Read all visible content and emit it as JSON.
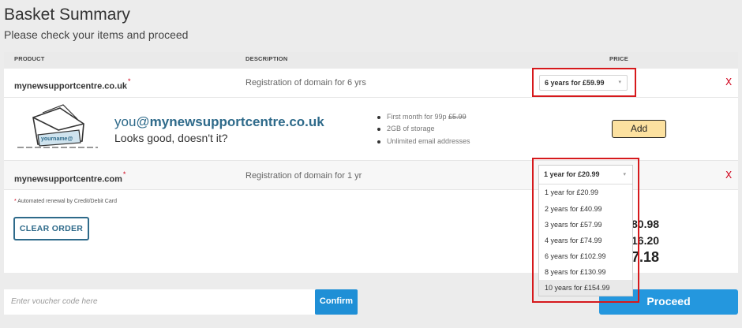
{
  "page": {
    "title": "Basket Summary",
    "subtitle": "Please check your items and proceed"
  },
  "table": {
    "headers": {
      "product": "PRODUCT",
      "description": "DESCRIPTION",
      "price": "PRICE"
    }
  },
  "items": [
    {
      "product": "mynewsupportcentre.co.uk",
      "asterisk": "*",
      "description": "Registration of domain for 6 yrs",
      "selected_price": "6 years for £59.99",
      "remove": "X"
    },
    {
      "product": "mynewsupportcentre.com",
      "asterisk": "*",
      "description": "Registration of domain for 1 yr",
      "selected_price": "1 year for £20.99",
      "remove": "X"
    }
  ],
  "email_upsell": {
    "envelope_text": "yourname@",
    "prefix": "you@",
    "domain": "mynewsupportcentre.co.uk",
    "tagline": "Looks good, doesn't it?",
    "features": {
      "first_month_prefix": "First month for 99p",
      "first_month_old_price": "£5.99",
      "storage": "2GB of storage",
      "addresses": "Unlimited email addresses"
    },
    "add_label": "Add"
  },
  "footer_note": {
    "asterisk": "*",
    "text": "Automated renewal by Credit/Debit Card"
  },
  "clear_label": "CLEAR ORDER",
  "totals_partial": [
    "80.98",
    "16.20",
    "7.18"
  ],
  "dropdown": {
    "selected": "1 year for £20.99",
    "options": [
      "1 year for £20.99",
      "2 years for £40.99",
      "3 years for £57.99",
      "4 years for £74.99",
      "6 years for £102.99",
      "8 years for £130.99",
      "10 years for £154.99"
    ]
  },
  "voucher": {
    "placeholder": "Enter voucher code here",
    "confirm_label": "Confirm"
  },
  "proceed_label": "Proceed",
  "icons": {
    "caret": "▾"
  },
  "colors": {
    "accent_blue": "#2497de",
    "link_blue": "#2e6a8a",
    "highlight_red": "#d6191c",
    "add_yellow": "#fce1a0"
  }
}
